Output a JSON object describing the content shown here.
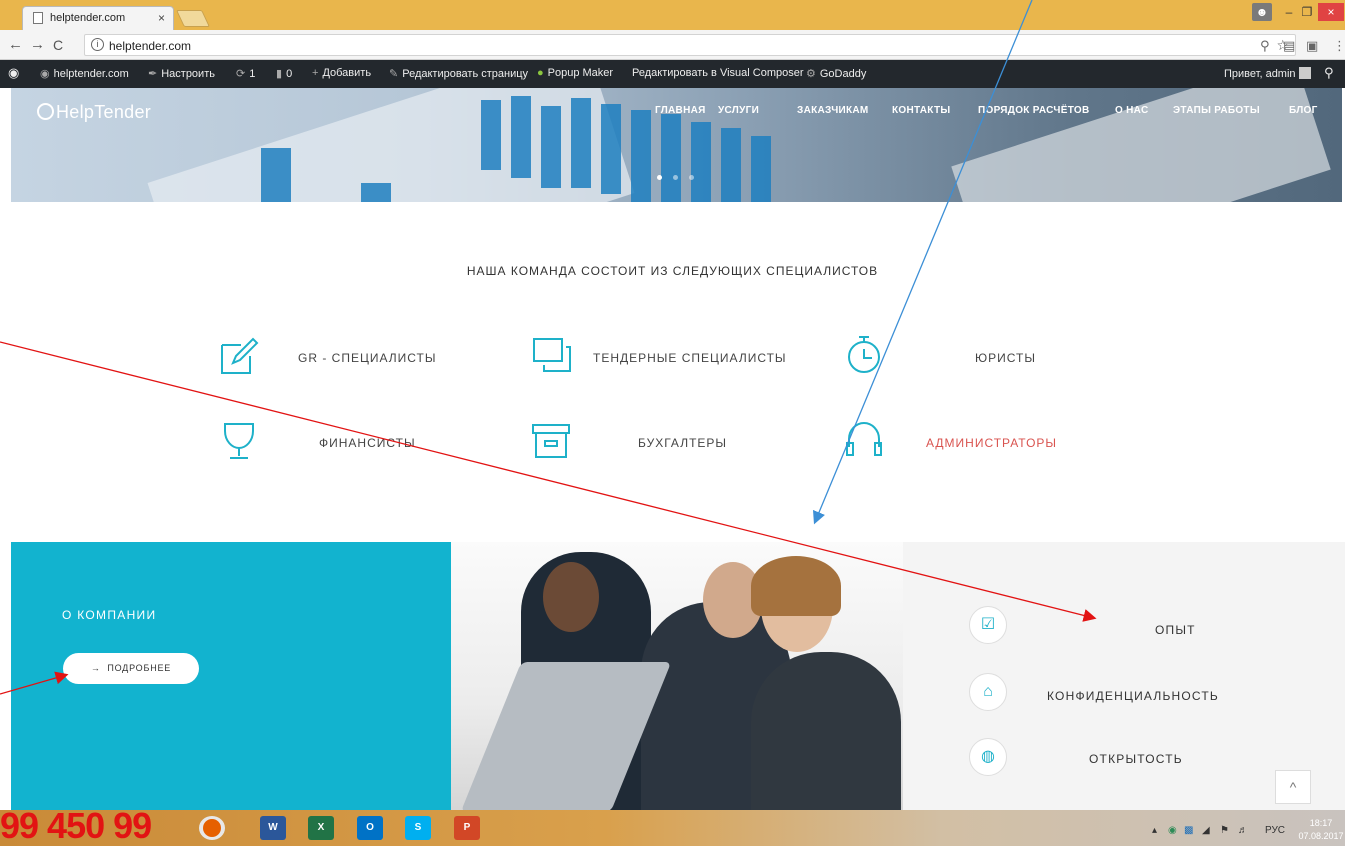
{
  "browser": {
    "tab_title": "helptender.com",
    "tab_close": "×",
    "url": "helptender.com",
    "back": "←",
    "forward": "→",
    "reload": "C",
    "info_glyph": "i",
    "bookmark_star": "☆"
  },
  "window": {
    "minimize": "–",
    "maximize": "❐",
    "close": "×"
  },
  "admin_bar": {
    "site_name": "helptender.com",
    "customize": "Настроить",
    "updates_count": "1",
    "comments_count": "0",
    "add_new": "Добавить",
    "edit_page": "Редактировать страницу",
    "popup_maker": "Popup Maker",
    "visual_composer": "Редактировать в Visual Composer",
    "godaddy": "GoDaddy",
    "greeting": "Привет, admin"
  },
  "site": {
    "logo": "HelpTender",
    "nav": [
      "ГЛАВНАЯ",
      "УСЛУГИ",
      "ЗАКАЗЧИКАМ",
      "КОНТАКТЫ",
      "ПОРЯДОК РАСЧЁТОВ",
      "О НАС",
      "ЭТАПЫ РАБОТЫ",
      "БЛОГ"
    ],
    "slider_dots": 3,
    "slider_active": 1
  },
  "team": {
    "title": "НАША КОМАНДА СОСТОИТ ИЗ СЛЕДУЮЩИХ СПЕЦИАЛИСТОВ",
    "specialists": [
      {
        "label": "GR - СПЕЦИАЛИСТЫ",
        "icon": "edit-icon"
      },
      {
        "label": "ТЕНДЕРНЫЕ СПЕЦИАЛИСТЫ",
        "icon": "windows-icon"
      },
      {
        "label": "ЮРИСТЫ",
        "icon": "stopwatch-icon"
      },
      {
        "label": "ФИНАНСИСТЫ",
        "icon": "trophy-icon"
      },
      {
        "label": "БУХГАЛТЕРЫ",
        "icon": "archive-icon"
      },
      {
        "label": "АДМИНИСТРАТОРЫ",
        "icon": "headphones-icon"
      }
    ]
  },
  "company": {
    "title": "О КОМПАНИИ",
    "more_button": "ПОДРОБНЕЕ",
    "arrow_glyph": "→",
    "features": [
      {
        "label": "ОПЫТ",
        "icon": "checkbox-icon",
        "glyph": "☑"
      },
      {
        "label": "КОНФИДЕНЦИАЛЬНОСТЬ",
        "icon": "mouse-icon",
        "glyph": "⌂"
      },
      {
        "label": "ОТКРЫТОСТЬ",
        "icon": "globe-icon",
        "glyph": "◍"
      }
    ],
    "scroll_top": "^"
  },
  "taskbar": {
    "phone_overlay": "99 450 99",
    "apps": [
      {
        "name": "firefox",
        "label": ""
      },
      {
        "name": "word",
        "label": "W"
      },
      {
        "name": "excel",
        "label": "X"
      },
      {
        "name": "outlook",
        "label": "O"
      },
      {
        "name": "skype",
        "label": "S"
      },
      {
        "name": "powerpoint",
        "label": "P"
      }
    ],
    "language": "РУС",
    "time": "18:17",
    "date": "07.08.2017"
  },
  "colors": {
    "accent": "#1eb1c9",
    "company_bg": "#12b3cf",
    "annotation_red": "#e21313",
    "annotation_blue": "#3c8fd6",
    "admin_bar": "#23282d"
  }
}
